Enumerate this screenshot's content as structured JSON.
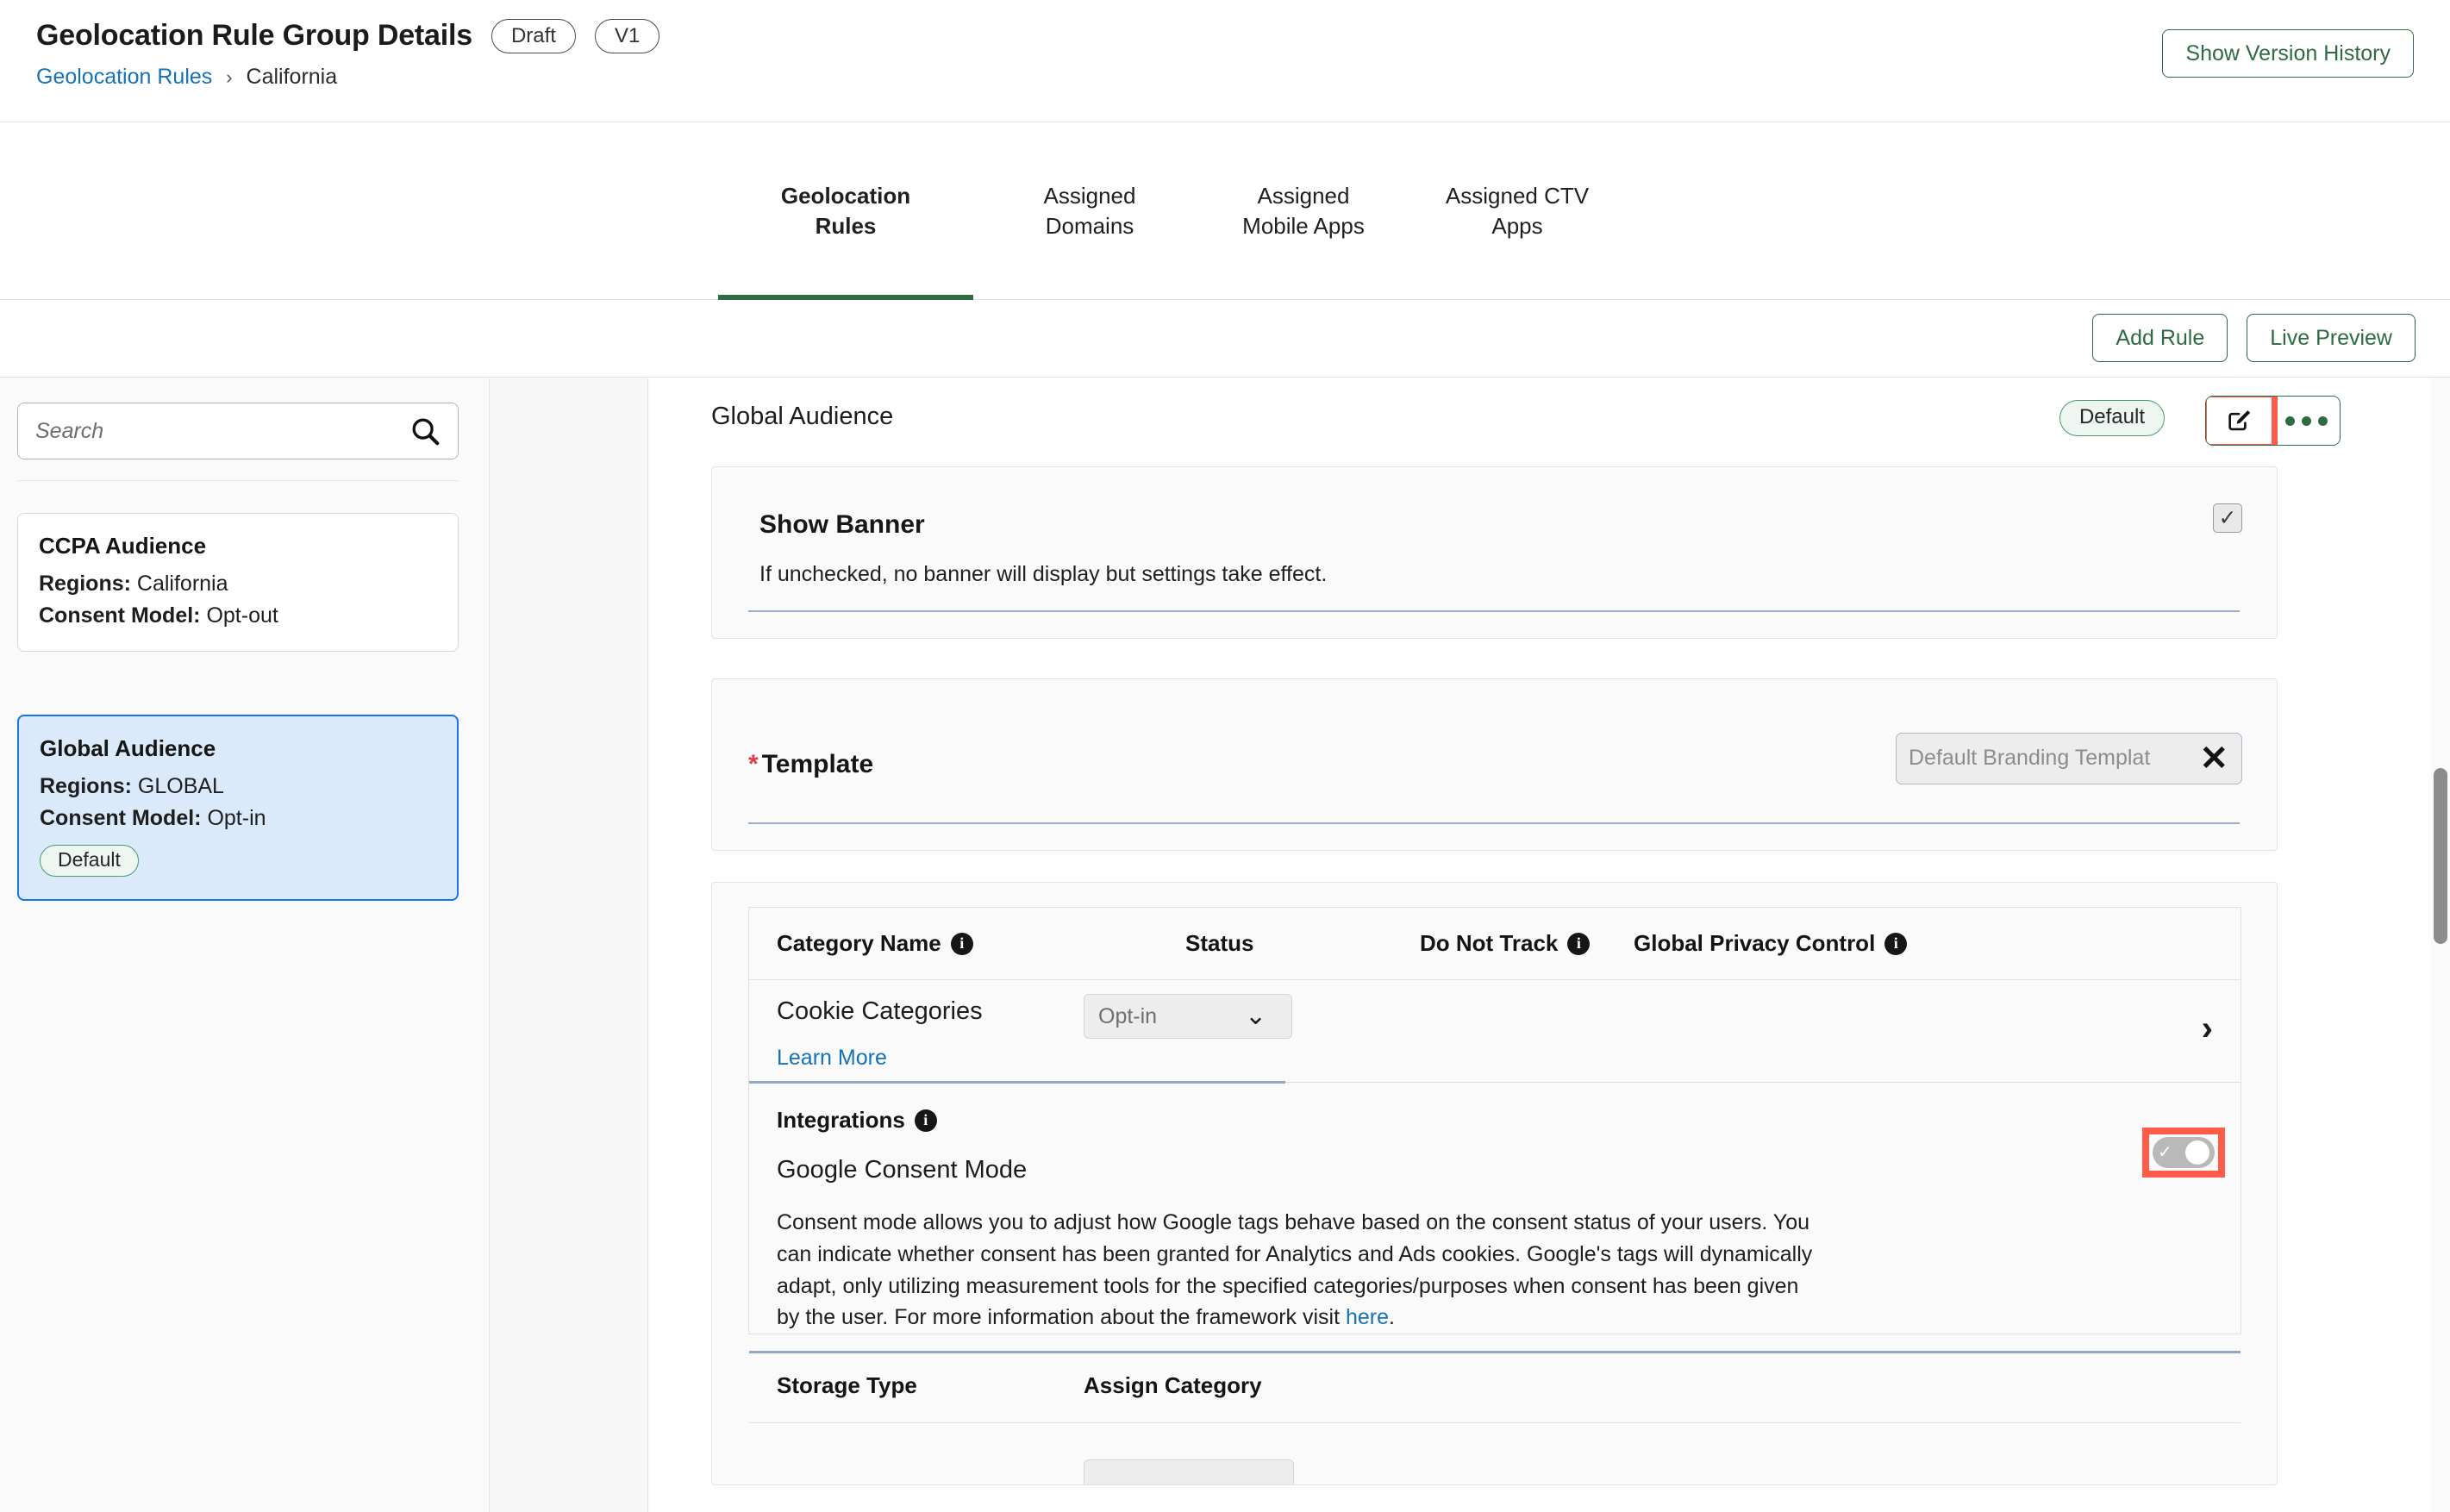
{
  "header": {
    "title": "Geolocation Rule Group Details",
    "status_badge": "Draft",
    "version_badge": "V1",
    "breadcrumb_link": "Geolocation Rules",
    "breadcrumb_sep": "›",
    "breadcrumb_current": "California",
    "show_version_history": "Show Version History"
  },
  "tabs": [
    {
      "label": "Geolocation Rules",
      "active": true
    },
    {
      "label": "Assigned Domains",
      "active": false
    },
    {
      "label": "Assigned Mobile Apps",
      "active": false
    },
    {
      "label": "Assigned CTV Apps",
      "active": false
    }
  ],
  "actionbar": {
    "add_rule": "Add Rule",
    "live_preview": "Live Preview"
  },
  "sidebar": {
    "search_placeholder": "Search",
    "cards": [
      {
        "title": "CCPA Audience",
        "regions_label": "Regions:",
        "regions_value": "California",
        "consent_label": "Consent Model:",
        "consent_value": "Opt-out",
        "badge": "",
        "selected": false
      },
      {
        "title": "Global Audience",
        "regions_label": "Regions:",
        "regions_value": "GLOBAL",
        "consent_label": "Consent Model:",
        "consent_value": "Opt-in",
        "badge": "Default",
        "selected": true
      }
    ]
  },
  "panel": {
    "title": "Global Audience",
    "chip": "Default",
    "edit_icon": "edit-pencil-icon",
    "more_icon": "more-options-icon"
  },
  "show_banner": {
    "title": "Show Banner",
    "description": "If unchecked, no banner will display but settings take effect.",
    "checked": true,
    "check_glyph": "✓"
  },
  "template": {
    "required_mark": "*",
    "label": "Template",
    "value": "Default Branding Templat",
    "clear_glyph": "✕"
  },
  "table": {
    "headers": {
      "category_name": "Category Name",
      "status": "Status",
      "do_not_track": "Do Not Track",
      "global_privacy_control": "Global Privacy Control"
    },
    "cookie_row": {
      "name": "Cookie Categories",
      "learn_more": "Learn More",
      "status_value": "Opt-in",
      "caret_glyph": "⌄",
      "expand_glyph": "›"
    },
    "integrations": {
      "label": "Integrations",
      "google_consent_mode_title": "Google Consent Mode",
      "google_consent_mode_desc_part1": "Consent mode allows you to adjust how Google tags behave based on the consent status of your users. You can indicate whether consent has been granted for Analytics and Ads cookies. Google's tags will dynamically adapt, only utilizing measurement tools for the specified categories/purposes when consent has been given by the user. For more information about the framework visit ",
      "google_consent_mode_desc_link": "here",
      "google_consent_mode_desc_part2": ".",
      "toggle_on": true,
      "toggle_glyph": "✓"
    },
    "storage_row": {
      "storage_type": "Storage Type",
      "assign_category": "Assign Category"
    },
    "info_glyph": "i"
  },
  "colors": {
    "accent_green": "#2e6b42",
    "link_blue": "#1473b8",
    "highlight_red": "#ff5b4a",
    "selected_card_bg": "#dbeafa",
    "selected_card_border": "#1a73e8",
    "badge_green_border": "#4a9a74",
    "required_red": "#e23b50"
  }
}
